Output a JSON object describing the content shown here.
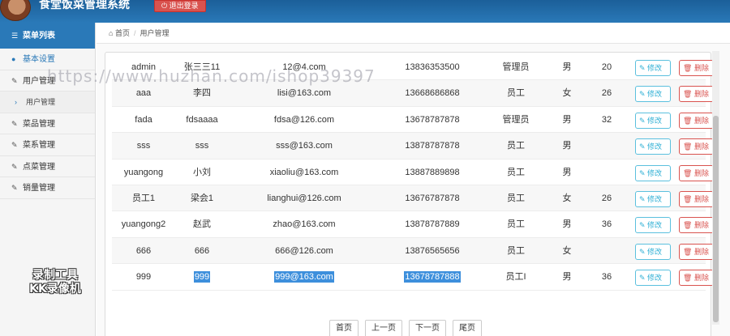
{
  "header": {
    "title": "食堂饭菜管理系统",
    "logout_label": "⏻ 退出登录"
  },
  "sidebar": {
    "heading": "菜单列表",
    "items": [
      {
        "label": "基本设置",
        "icon": "user-icon"
      },
      {
        "label": "用户管理",
        "icon": "edit-icon"
      },
      {
        "label": "用户管理",
        "icon": "caret-right-icon"
      },
      {
        "label": "菜品管理",
        "icon": "edit-icon"
      },
      {
        "label": "菜系管理",
        "icon": "edit-icon"
      },
      {
        "label": "点菜管理",
        "icon": "edit-icon"
      },
      {
        "label": "销量管理",
        "icon": "edit-icon"
      }
    ]
  },
  "breadcrumb": {
    "home": "首页",
    "current": "用户管理"
  },
  "table": {
    "edit_label": "修改",
    "delete_label": "删除",
    "rows": [
      {
        "username": "admin",
        "name": "张三三11",
        "email": "12@4.com",
        "phone": "13836353500",
        "role": "管理员",
        "sex": "男",
        "age": "20"
      },
      {
        "username": "aaa",
        "name": "李四",
        "email": "lisi@163.com",
        "phone": "13668686868",
        "role": "员工",
        "sex": "女",
        "age": "26"
      },
      {
        "username": "fada",
        "name": "fdsaaaa",
        "email": "fdsa@126.com",
        "phone": "13678787878",
        "role": "管理员",
        "sex": "男",
        "age": "32"
      },
      {
        "username": "sss",
        "name": "sss",
        "email": "sss@163.com",
        "phone": "13878787878",
        "role": "员工",
        "sex": "男",
        "age": ""
      },
      {
        "username": "yuangong",
        "name": "小刘",
        "email": "xiaoliu@163.com",
        "phone": "13887889898",
        "role": "员工",
        "sex": "男",
        "age": ""
      },
      {
        "username": "员工1",
        "name": "梁会1",
        "email": "lianghui@126.com",
        "phone": "13676787878",
        "role": "员工",
        "sex": "女",
        "age": "26"
      },
      {
        "username": "yuangong2",
        "name": "赵武",
        "email": "zhao@163.com",
        "phone": "13878787889",
        "role": "员工",
        "sex": "男",
        "age": "36"
      },
      {
        "username": "666",
        "name": "666",
        "email": "666@126.com",
        "phone": "13876565656",
        "role": "员工",
        "sex": "女",
        "age": ""
      },
      {
        "username": "999",
        "name": "999",
        "email": "999@163.com",
        "phone": "13678787888",
        "role": "员工I",
        "sex": "男",
        "age": "36"
      }
    ]
  },
  "pager": {
    "first": "首页",
    "prev": "上一页",
    "next": "下一页",
    "last": "尾页"
  },
  "overlays": {
    "watermark": "https://www.huzhan.com/ishop39397",
    "tool_line1": "录制工具",
    "tool_line2": "KK录像机"
  },
  "colors": {
    "header": "#2a79b8",
    "edit": "#5bc0de",
    "delete": "#d9534f",
    "selection": "#3d8fdc"
  }
}
